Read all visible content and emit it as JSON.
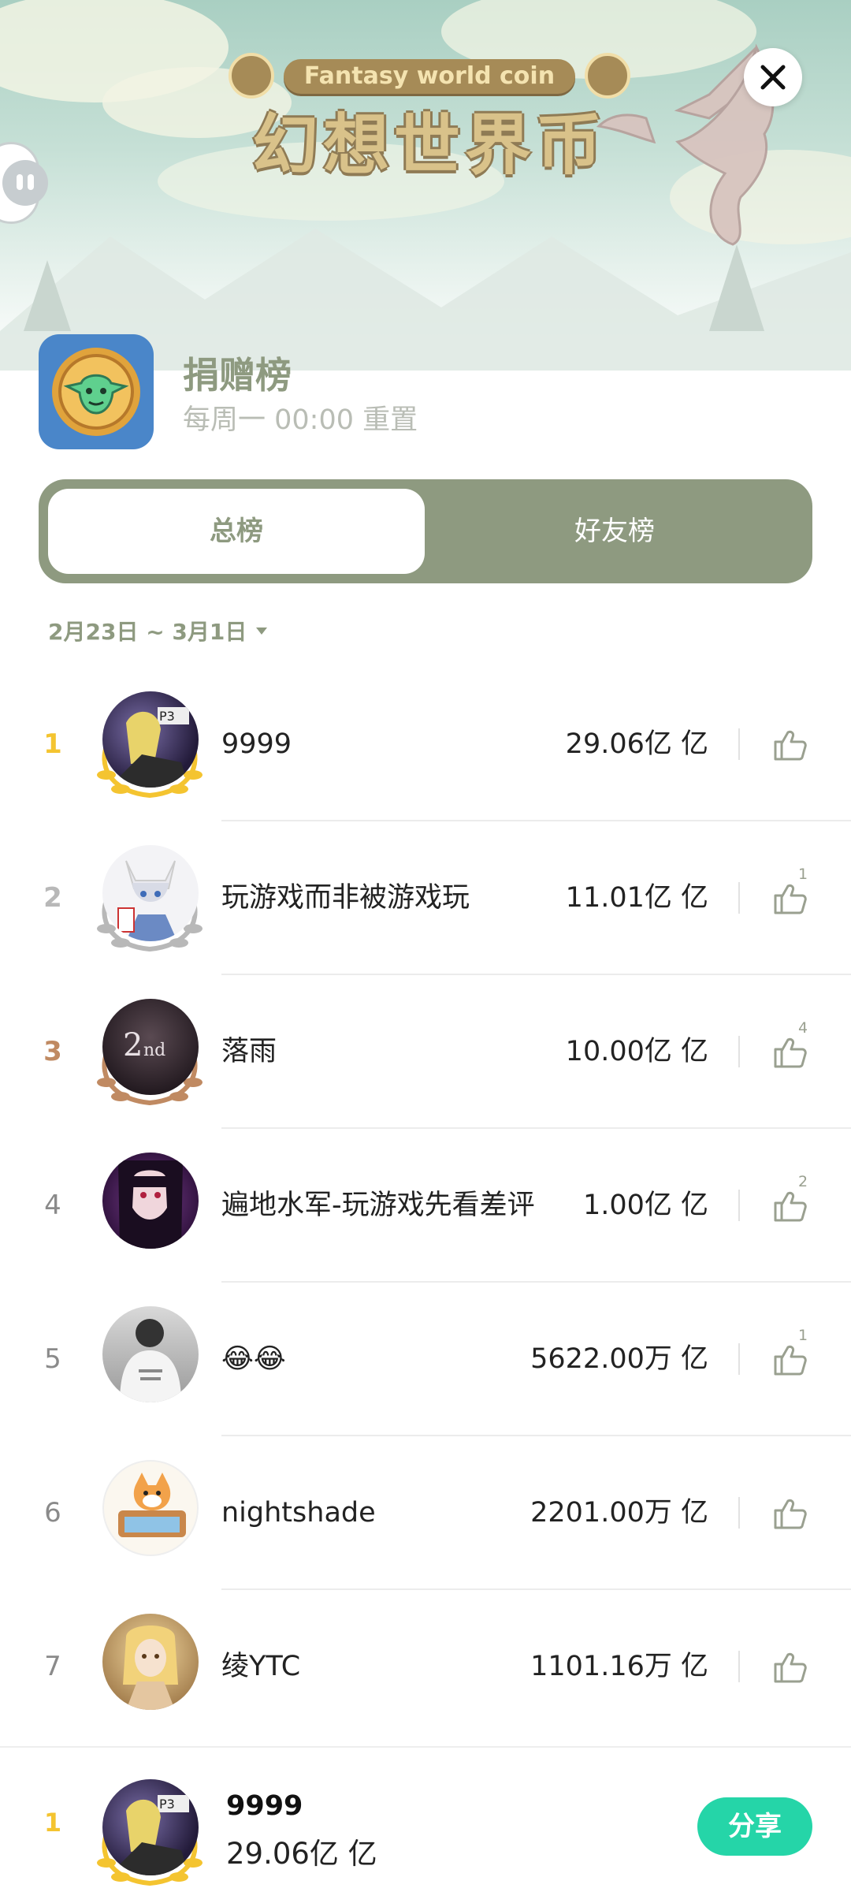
{
  "banner": {
    "title_en": "Fantasy world coin",
    "title_cn": "幻想世界币"
  },
  "close_icon": "close-icon",
  "header": {
    "title": "捐赠榜",
    "subtitle": "每周一 00:00 重置"
  },
  "tabs": [
    {
      "label": "总榜",
      "active": true
    },
    {
      "label": "好友榜",
      "active": false
    }
  ],
  "date_range": "2月23日 ~ 3月1日",
  "colors": {
    "accent": "#8e9a80",
    "share": "#25d5a8",
    "gold": "#f4c430",
    "silver": "#b8b8b8",
    "bronze": "#c08a62"
  },
  "rows": [
    {
      "rank": "1",
      "name": "9999",
      "value": "29.06亿 亿",
      "likes": ""
    },
    {
      "rank": "2",
      "name": "玩游戏而非被游戏玩",
      "value": "11.01亿 亿",
      "likes": "1"
    },
    {
      "rank": "3",
      "name": "落雨",
      "value": "10.00亿 亿",
      "likes": "4"
    },
    {
      "rank": "4",
      "name": "遍地水军-玩游戏先看差评",
      "value": "1.00亿 亿",
      "likes": "2"
    },
    {
      "rank": "5",
      "name": "😂😂",
      "value": "5622.00万 亿",
      "likes": "1"
    },
    {
      "rank": "6",
      "name": "nightshade",
      "value": "2201.00万 亿",
      "likes": ""
    },
    {
      "rank": "7",
      "name": "绫YTC",
      "value": "1101.16万 亿",
      "likes": ""
    }
  ],
  "me": {
    "rank": "1",
    "name": "9999",
    "value": "29.06亿 亿",
    "share_label": "分享"
  }
}
